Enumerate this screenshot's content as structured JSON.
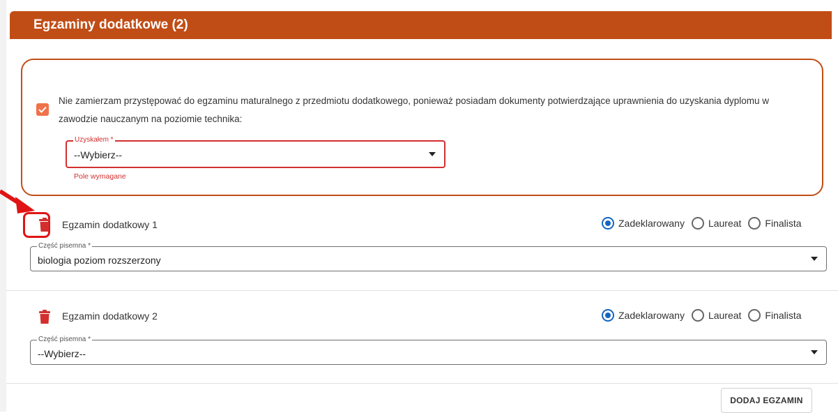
{
  "header": {
    "title": "Egzaminy dodatkowe (2)"
  },
  "declaration": {
    "text": "Nie zamierzam przystępować do egzaminu maturalnego z przedmiotu dodatkowego, ponieważ posiadam dokumenty potwierdzające uprawnienia do uzyskania dyplomu w zawodzie nauczanym na poziomie technika:",
    "checked": true,
    "select_label": "Uzyskałem *",
    "select_value": "--Wybierz--",
    "error": "Pole wymagane"
  },
  "exams": [
    {
      "title": "Egzamin dodatkowy 1",
      "radios": [
        "Zadeklarowany",
        "Laureat",
        "Finalista"
      ],
      "selected": "Zadeklarowany",
      "select_label": "Część pisemna *",
      "select_value": "biologia poziom rozszerzony"
    },
    {
      "title": "Egzamin dodatkowy 2",
      "radios": [
        "Zadeklarowany",
        "Laureat",
        "Finalista"
      ],
      "selected": "Zadeklarowany",
      "select_label": "Część pisemna *",
      "select_value": "--Wybierz--"
    }
  ],
  "add_button": "DODAJ EGZAMIN",
  "colors": {
    "accent": "#c14d16",
    "checkbox": "#f0724a",
    "error": "#d32f2f",
    "radio": "#1565c0",
    "trash": "#d32f2f",
    "highlight": "#e01414"
  },
  "icons": {
    "delete": "trash-icon",
    "checkbox": "check-icon",
    "select": "caret-down-icon",
    "annotation": "red-arrow-icon"
  }
}
